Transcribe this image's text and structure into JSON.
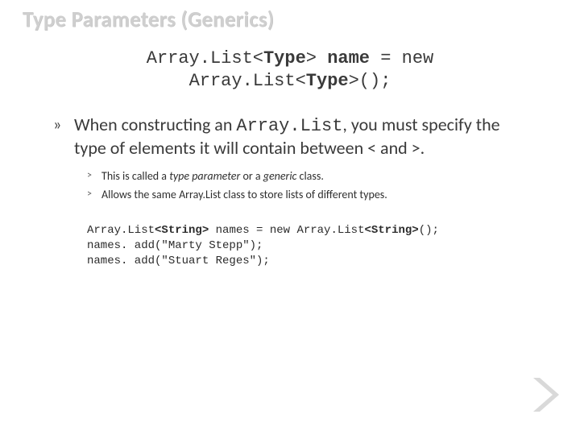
{
  "title": "Type Parameters (Generics)",
  "syntax": {
    "line1_pre": "Array.List<",
    "line1_bold1": "Type",
    "line1_mid": "> ",
    "line1_bold2": "name",
    "line1_post": " = new",
    "line2_pre": "Array.List<",
    "line2_bold": "Type",
    "line2_post": ">();"
  },
  "bullet1": {
    "marker": "»",
    "text_a": "When constructing an ",
    "code": "Array.List",
    "text_b": ", you must specify the",
    "text_c": "type of elements it will contain between < and >."
  },
  "sub": [
    {
      "marker": "˃",
      "pre": "This is called a ",
      "em1": "type parameter",
      "mid": " or a ",
      "em2": "generic",
      "post": " class."
    },
    {
      "marker": "˃",
      "pre": "Allows the same ",
      "mono": "Array.List",
      "post": " class to store lists of different types."
    }
  ],
  "code": {
    "l1a": "Array.List",
    "l1b": "<String>",
    "l1c": " names = new Array.List",
    "l1d": "<String>",
    "l1e": "();",
    "l2": "names. add(\"Marty Stepp\");",
    "l3": "names. add(\"Stuart Reges\");"
  },
  "chevron_name": "chevron-right-icon"
}
